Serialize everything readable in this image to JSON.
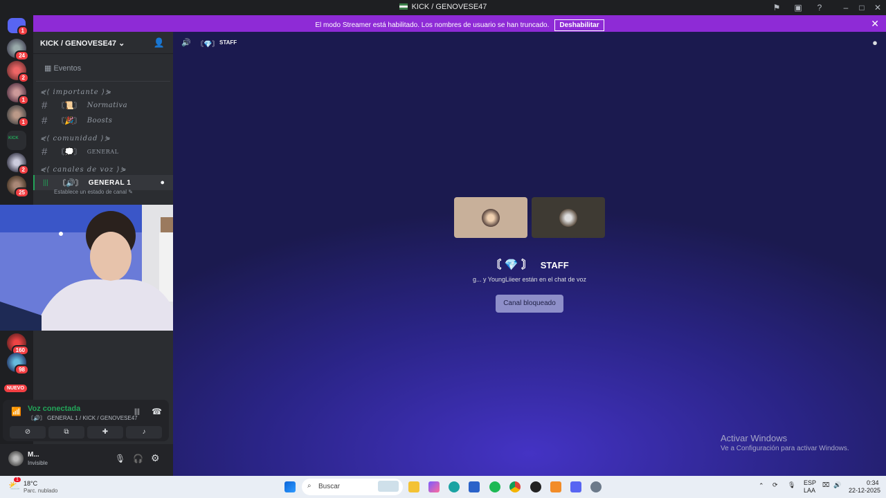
{
  "window": {
    "title": "KICK / GENOVESE47"
  },
  "banner": {
    "text": "El modo Streamer está habilitado. Los nombres de usuario se han truncado.",
    "button": "Deshabilitar"
  },
  "guilds": [
    {
      "badge": "1"
    },
    {
      "badge": "24"
    },
    {
      "badge": "2"
    },
    {
      "badge": "1"
    },
    {
      "badge": "1"
    },
    {
      "badge": ""
    },
    {
      "badge": "2"
    },
    {
      "badge": "25"
    },
    {
      "badge": "160"
    },
    {
      "badge": "98"
    }
  ],
  "guild_new_label": "NUEVO",
  "sidebar": {
    "server_name": "KICK / GENOVESE47",
    "events_label": "Eventos",
    "categories": [
      {
        "label": "⋞⟨ importante ⟩⋟"
      },
      {
        "label": "⋞⟨ comunidad ⟩⋟"
      },
      {
        "label": "⋞⟨ canales de voz ⟩⋟"
      }
    ],
    "channels": [
      {
        "label": "Normativa",
        "deco": "〘📜〙"
      },
      {
        "label": "Boosts",
        "deco": "〘🎉〙"
      },
      {
        "label": "GENERAL",
        "deco": "〘💭〙"
      }
    ],
    "voice_channel": {
      "deco": "〘🔊〙",
      "label": "GENERAL 1",
      "status": "Establece un estado de canal"
    }
  },
  "voice": {
    "status": "Voz conectada",
    "location": "〘🔊〙 GENERAL 1 / KICK / GENOVESE47"
  },
  "user": {
    "name": "M...",
    "status": "Invisible"
  },
  "channel_header": {
    "deco": "〘💎〙",
    "name": "STAFF"
  },
  "main": {
    "channel_title": "STAFF",
    "channel_deco": "〘 💎 〙",
    "participants_text": "g... y YoungLiieer están en el chat de voz",
    "locked_button": "Canal bloqueado"
  },
  "activate_windows": {
    "line1": "Activar Windows",
    "line2": "Ve a Configuración para activar Windows."
  },
  "taskbar": {
    "weather_temp": "18°C",
    "weather_desc": "Parc. nublado",
    "weather_badge": "1",
    "search_placeholder": "Buscar",
    "lang_top": "ESP",
    "lang_bottom": "LAA",
    "time": "0:34",
    "date": "22-12-2025"
  },
  "colors": {
    "accent": "#8e2bd6",
    "online": "#23a559",
    "badge": "#f23f43"
  }
}
